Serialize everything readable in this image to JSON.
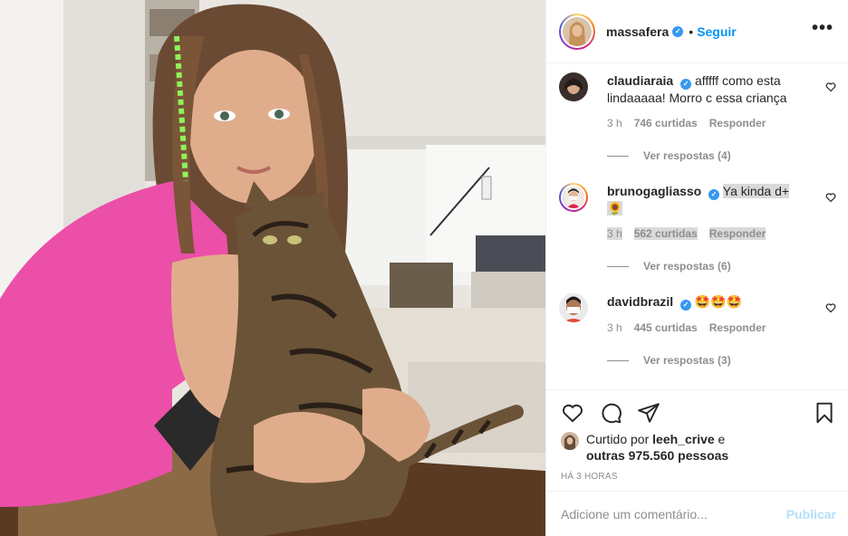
{
  "post": {
    "username": "massafera",
    "follow_label": "Seguir",
    "separator": "•",
    "more_label": "•••"
  },
  "comments": [
    {
      "user": "claudiaraia",
      "verified": true,
      "text": "afffff como esta lindaaaaa! Morro c essa criança",
      "time": "3 h",
      "likes": "746 curtidas",
      "reply_label": "Responder",
      "view_replies": "Ver respostas (4)"
    },
    {
      "user": "brunogagliasso",
      "verified": true,
      "text": "Ya kinda d+",
      "emoji": "🌻",
      "time": "3 h",
      "likes": "562 curtidas",
      "reply_label": "Responder",
      "view_replies": "Ver respostas (6)"
    },
    {
      "user": "davidbrazil",
      "verified": true,
      "text": "🤩🤩🤩",
      "time": "3 h",
      "likes": "445 curtidas",
      "reply_label": "Responder",
      "view_replies": "Ver respostas (3)"
    }
  ],
  "likes": {
    "prefix": "Curtido por",
    "liker": "leeh_crive",
    "joiner": "e",
    "others": "outras 975.560 pessoas"
  },
  "timestamp": "HÁ 3 HORAS",
  "add_comment": {
    "placeholder": "Adicione um comentário...",
    "publish_label": "Publicar"
  },
  "icons": {
    "like": "heart-icon",
    "comment": "comment-icon",
    "share": "share-icon",
    "save": "bookmark-icon",
    "more": "more-icon",
    "verified": "verified-badge-icon"
  },
  "colors": {
    "link": "#0095f6",
    "verified": "#3897f0",
    "publish_disabled": "#b2dffc",
    "muted": "#8e8e8e"
  }
}
